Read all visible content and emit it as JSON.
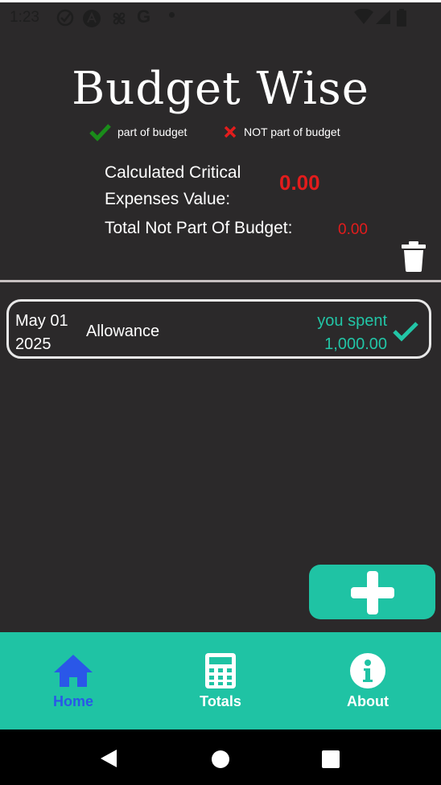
{
  "status_bar": {
    "time": "1:23"
  },
  "app": {
    "title": "Budget Wise"
  },
  "legend": {
    "part_label": "part of budget",
    "not_part_label": "NOT part of budget"
  },
  "summary": {
    "critical_label_line1": "Calculated Critical",
    "critical_label_line2": "Expenses Value:",
    "critical_value": "0.00",
    "not_part_label": "Total Not Part Of Budget:",
    "not_part_value": "0.00"
  },
  "entries": [
    {
      "date_line1": "May 01",
      "date_line2": "2025",
      "name": "Allowance",
      "spent_label": "you spent",
      "amount": "1,000.00",
      "status": "part of budget"
    }
  ],
  "bottom_nav": {
    "items": [
      {
        "label": "Home",
        "icon": "home-icon",
        "active": true
      },
      {
        "label": "Totals",
        "icon": "calculator-icon",
        "active": false
      },
      {
        "label": "About",
        "icon": "info-icon",
        "active": false
      }
    ]
  },
  "colors": {
    "accent": "#1fc3a4",
    "negative": "#e31c1c",
    "active_nav": "#2a57e8",
    "background": "#2b292a"
  }
}
